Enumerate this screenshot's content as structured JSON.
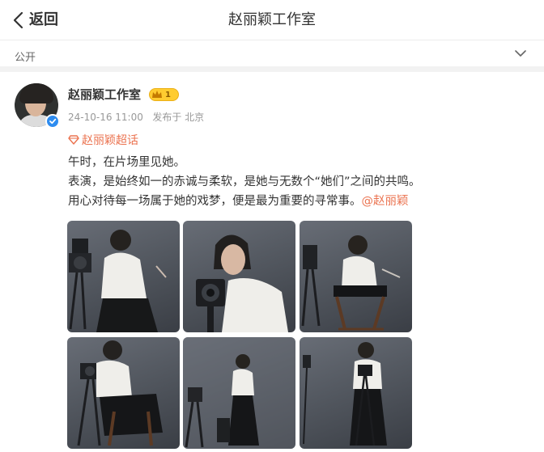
{
  "nav": {
    "back_label": "返回",
    "title": "赵丽颖工作室"
  },
  "visibility": {
    "label": "公开"
  },
  "post": {
    "user_name": "赵丽颖工作室",
    "member_level": "1",
    "timestamp": "24-10-16 11:00",
    "source": "发布于 北京",
    "supertopic": "赵丽颖超话",
    "lines": [
      "午时，在片场里见她。",
      "表演，是始终如一的赤诚与柔软，是她与无数个“她们”之间的共鸣。",
      "用心对待每一场属于她的戏梦，便是最为重要的寻常事。"
    ],
    "mention": "@赵丽颖",
    "photo_count": 6
  },
  "colors": {
    "accent": "#eb7350",
    "verified": "#2d8cf0",
    "member_gold": "#ffcc30"
  },
  "icons": {
    "back": "chevron-left-icon",
    "visibility": "chevron-down-icon",
    "verified": "verified-badge-icon",
    "member": "crown-icon",
    "supertopic": "diamond-icon"
  }
}
